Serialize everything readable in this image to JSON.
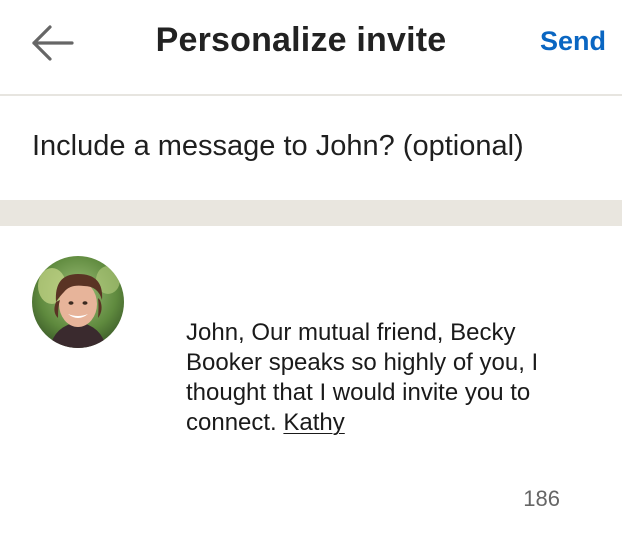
{
  "header": {
    "back_icon": "arrow-left-icon",
    "title": "Personalize invite",
    "send_label": "Send",
    "accent_color": "#0a66c2"
  },
  "prompt": {
    "text": "Include a message to John? (optional)"
  },
  "message": {
    "avatar_icon": "profile-photo",
    "body": "John, Our mutual friend, Becky Booker speaks so highly of you, I thought that I would invite you to connect. ",
    "signature": "Kathy",
    "char_count": "186"
  }
}
